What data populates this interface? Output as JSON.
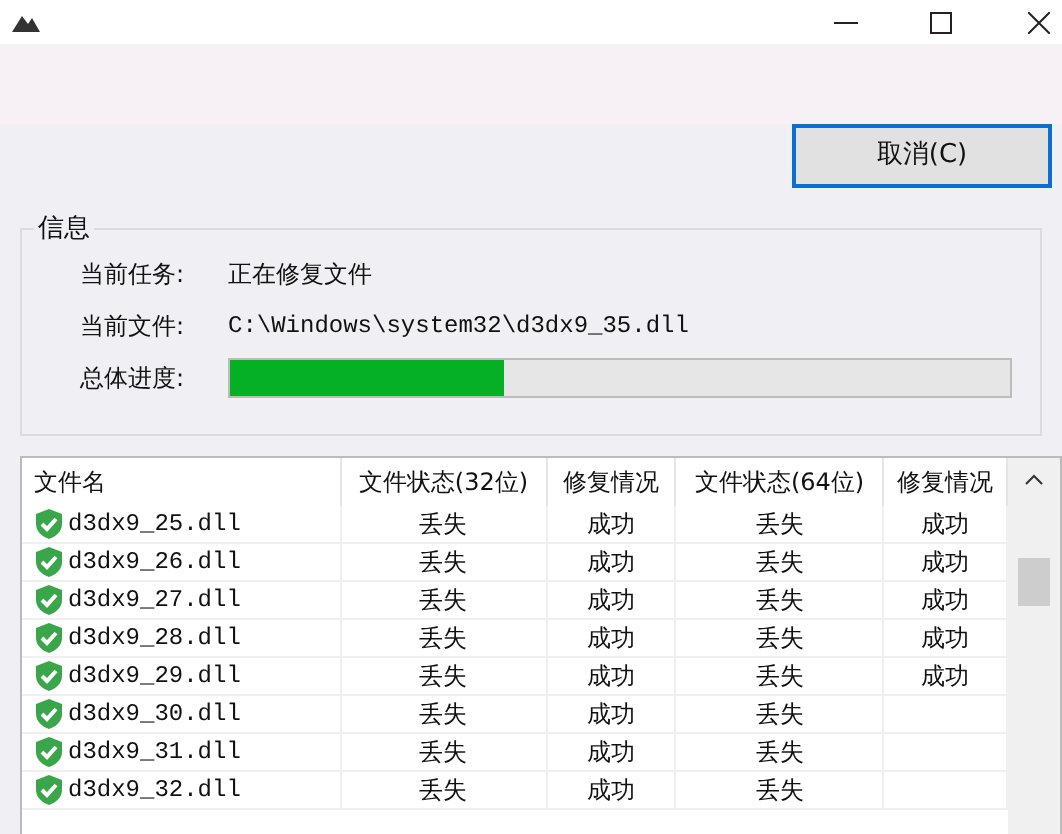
{
  "buttons": [
    {
      "label": "取消(C)"
    }
  ],
  "info": {
    "title": "信息",
    "fields": [
      {
        "label": "当前任务:",
        "value": "正在修复文件",
        "kind": "text"
      },
      {
        "label": "当前文件:",
        "value": "C:\\Windows\\system32\\d3dx9_35.dll",
        "kind": "mono"
      },
      {
        "label": "总体进度:",
        "level": 0.35,
        "kind": "progress"
      }
    ]
  },
  "table": {
    "columns": [
      "文件名",
      "文件状态(32位)",
      "修复情况",
      "文件状态(64位)",
      "修复情况"
    ],
    "rows": [
      [
        "d3dx9_25.dll",
        "丢失",
        "成功",
        "丢失",
        "成功"
      ],
      [
        "d3dx9_26.dll",
        "丢失",
        "成功",
        "丢失",
        "成功"
      ],
      [
        "d3dx9_27.dll",
        "丢失",
        "成功",
        "丢失",
        "成功"
      ],
      [
        "d3dx9_28.dll",
        "丢失",
        "成功",
        "丢失",
        "成功"
      ],
      [
        "d3dx9_29.dll",
        "丢失",
        "成功",
        "丢失",
        "成功"
      ],
      [
        "d3dx9_30.dll",
        "丢失",
        "成功",
        "丢失",
        ""
      ],
      [
        "d3dx9_31.dll",
        "丢失",
        "成功",
        "丢失",
        ""
      ],
      [
        "d3dx9_32.dll",
        "丢失",
        "成功",
        "丢失",
        ""
      ]
    ]
  }
}
